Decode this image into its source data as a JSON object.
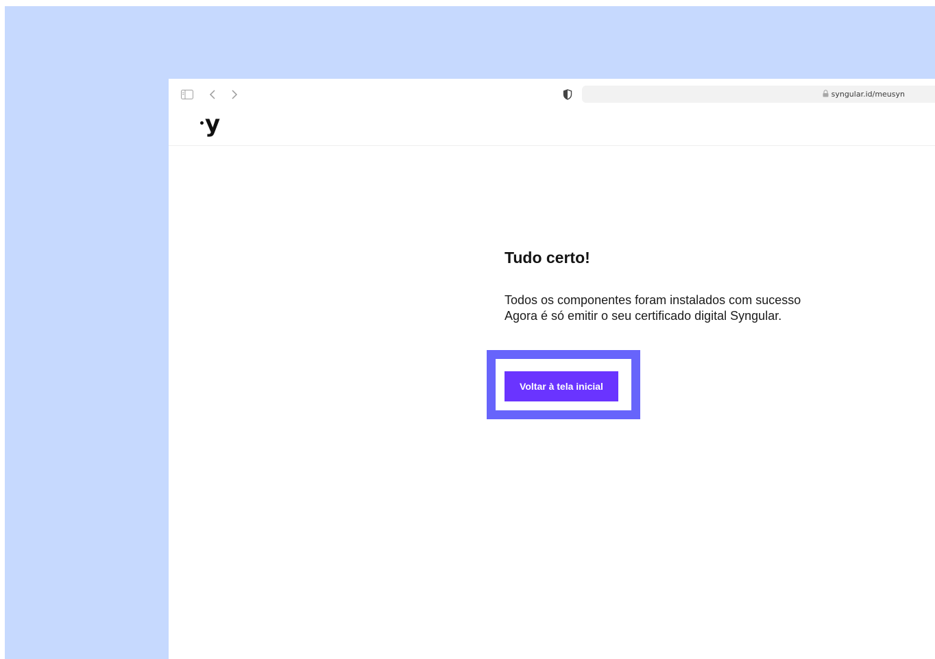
{
  "browser": {
    "url": "syngular.id/meusyn",
    "icons": {
      "sidebar": "sidebar-toggle-icon",
      "back": "chevron-left-icon",
      "forward": "chevron-right-icon",
      "shield": "shield-icon",
      "lock": "lock-icon"
    }
  },
  "header": {
    "logo_text": "y"
  },
  "main": {
    "title": "Tudo certo!",
    "description_lines": [
      "Todos os componentes foram instalados com sucesso",
      "Agora é só emitir o seu certificado digital Syngular."
    ],
    "button_label": "Voltar à tela inicial"
  },
  "colors": {
    "backdrop": "#c6d9fe",
    "highlight_frame": "#6764fb",
    "button": "#6a34ff"
  }
}
